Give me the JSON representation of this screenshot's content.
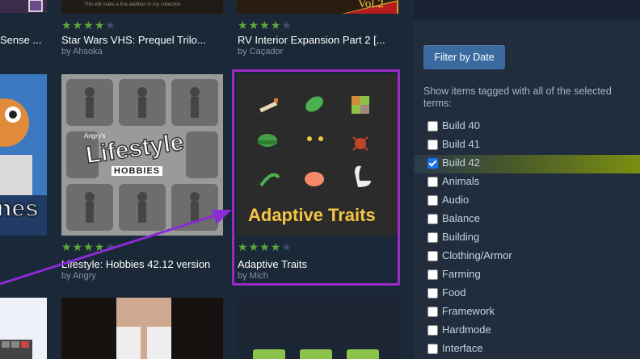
{
  "items": [
    {
      "title": "Sense ...",
      "author": "",
      "rating": 0
    },
    {
      "title": "Star Wars VHS: Prequel Trilo...",
      "author": "by Ahsoka",
      "rating": 4
    },
    {
      "title": "RV Interior Expansion Part 2 [...",
      "author": "by Caçador",
      "rating": 4
    },
    {
      "title": "Lifestyle: Hobbies 42.12 version",
      "author": "by Angry",
      "rating": 4
    },
    {
      "title": "Adaptive Traits",
      "author": "by Mich",
      "rating": 4
    }
  ],
  "thumbs": {
    "rv_badge": "Vol.2",
    "lifestyle_word": "Lifestyle",
    "lifestyle_sub": "HOBBIES",
    "lifestyle_brand": "Angry's",
    "adaptive_word": "Adaptive Traits",
    "left_partial": "nes",
    "sw_caption": "This will make a fine addition to my collection"
  },
  "sidebar": {
    "filter_button": "Filter by Date",
    "tag_description": "Show items tagged with all of the selected terms:",
    "tags": [
      {
        "label": "Build 40",
        "checked": false
      },
      {
        "label": "Build 41",
        "checked": false
      },
      {
        "label": "Build 42",
        "checked": true
      },
      {
        "label": "Animals",
        "checked": false
      },
      {
        "label": "Audio",
        "checked": false
      },
      {
        "label": "Balance",
        "checked": false
      },
      {
        "label": "Building",
        "checked": false
      },
      {
        "label": "Clothing/Armor",
        "checked": false
      },
      {
        "label": "Farming",
        "checked": false
      },
      {
        "label": "Food",
        "checked": false
      },
      {
        "label": "Framework",
        "checked": false
      },
      {
        "label": "Hardmode",
        "checked": false
      },
      {
        "label": "Interface",
        "checked": false
      }
    ]
  },
  "colors": {
    "highlight": "#9b2bc4",
    "arrow": "#8a2bd6",
    "star_on": "#5fa839",
    "star_off": "#3d4f66",
    "accent_button": "#3b6aa0",
    "selected_row": "#7a8f10"
  }
}
